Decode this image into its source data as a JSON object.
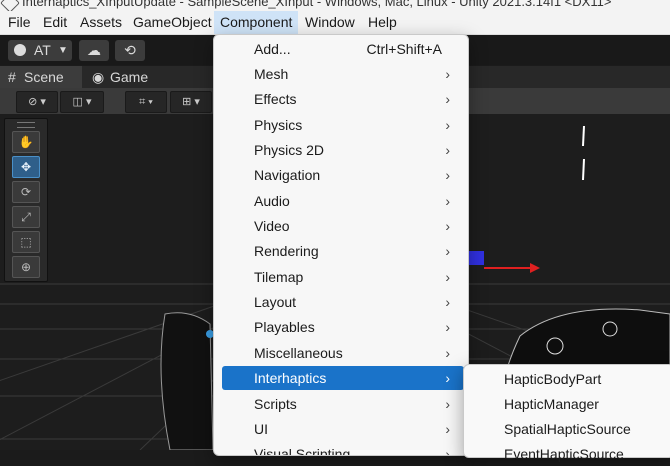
{
  "window": {
    "title": "Interhaptics_XInputUpdate - SampleScene_XInput - Windows, Mac, Linux - Unity 2021.3.14f1 <DX11>"
  },
  "menubar": {
    "items": [
      {
        "label": "File"
      },
      {
        "label": "Edit"
      },
      {
        "label": "Assets"
      },
      {
        "label": "GameObject"
      },
      {
        "label": "Component"
      },
      {
        "label": "Window"
      },
      {
        "label": "Help"
      }
    ],
    "active": "Component"
  },
  "toolbar": {
    "account_label": "AT"
  },
  "tabs": [
    {
      "label": "Scene"
    },
    {
      "label": "Game"
    }
  ],
  "component_menu": {
    "items": [
      {
        "label": "Add...",
        "shortcut": "Ctrl+Shift+A",
        "submenu": false
      },
      {
        "label": "Mesh",
        "submenu": true
      },
      {
        "label": "Effects",
        "submenu": true
      },
      {
        "label": "Physics",
        "submenu": true
      },
      {
        "label": "Physics 2D",
        "submenu": true
      },
      {
        "label": "Navigation",
        "submenu": true
      },
      {
        "label": "Audio",
        "submenu": true
      },
      {
        "label": "Video",
        "submenu": true
      },
      {
        "label": "Rendering",
        "submenu": true
      },
      {
        "label": "Tilemap",
        "submenu": true
      },
      {
        "label": "Layout",
        "submenu": true
      },
      {
        "label": "Playables",
        "submenu": true
      },
      {
        "label": "Miscellaneous",
        "submenu": true
      },
      {
        "label": "Interhaptics",
        "submenu": true,
        "highlighted": true
      },
      {
        "label": "Scripts",
        "submenu": true
      },
      {
        "label": "UI",
        "submenu": true
      },
      {
        "label": "Visual Scripting",
        "submenu": true
      }
    ]
  },
  "interhaptics_submenu": {
    "items": [
      {
        "label": "HapticBodyPart"
      },
      {
        "label": "HapticManager"
      },
      {
        "label": "SpatialHapticSource"
      },
      {
        "label": "EventHapticSource"
      }
    ]
  },
  "colors": {
    "highlight": "#1a73c9",
    "menubar_active": "#cfe3f7",
    "editor_dark": "#1d1d1d"
  },
  "icons": [
    "unity-logo-icon",
    "account-icon",
    "cloud-icon",
    "collab-icon",
    "hand-tool-icon",
    "move-tool-icon",
    "rotate-tool-icon",
    "scale-tool-icon",
    "rect-tool-icon",
    "transform-tool-icon",
    "chevron-right-icon"
  ]
}
